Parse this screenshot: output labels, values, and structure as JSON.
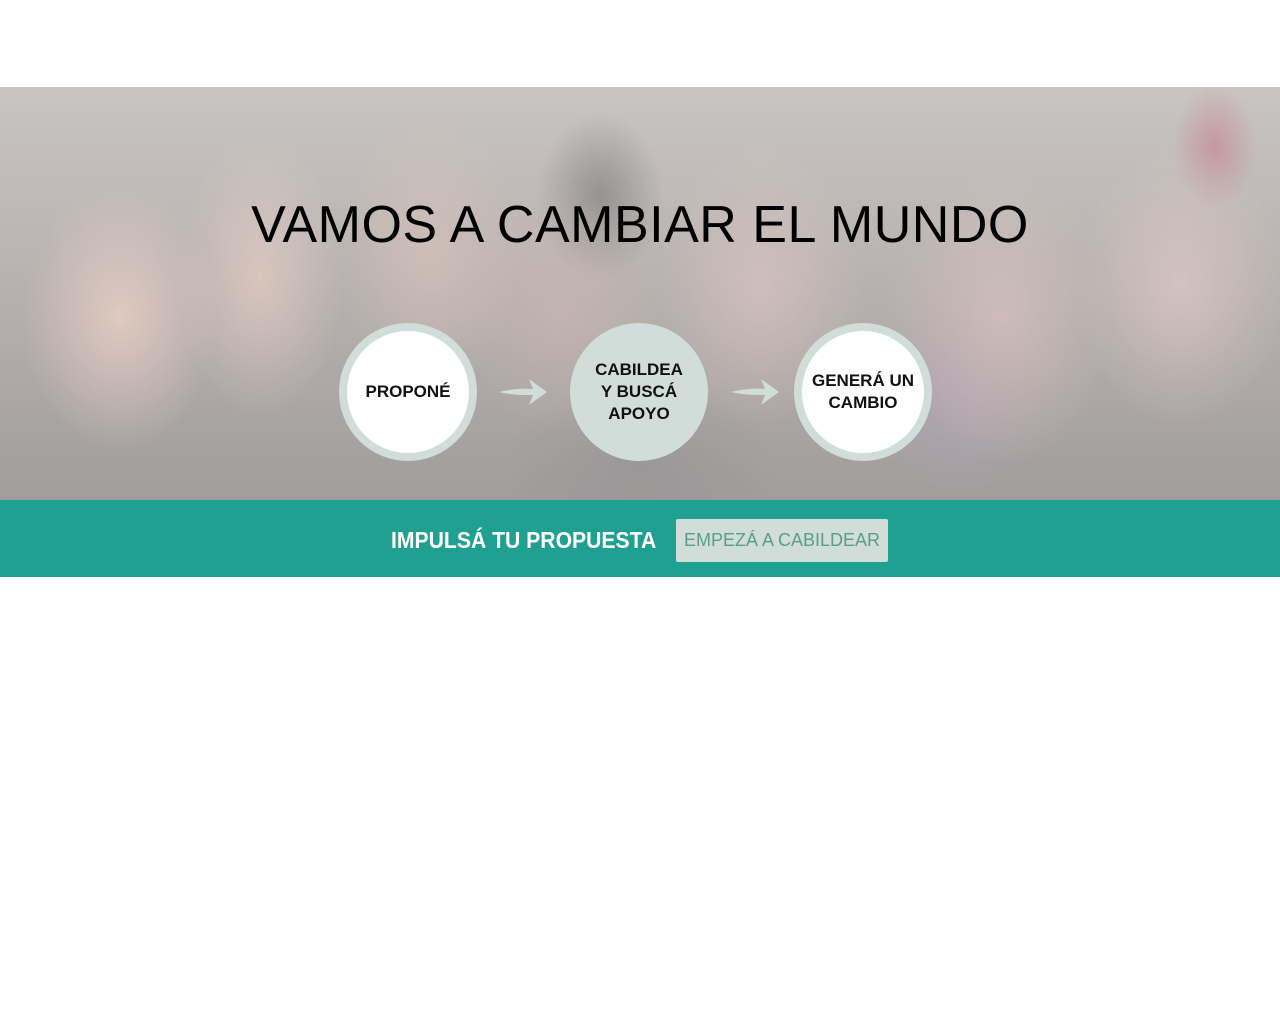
{
  "hero": {
    "title": "VAMOS A CAMBIAR EL MUNDO",
    "steps": [
      {
        "label": "PROPONÉ"
      },
      {
        "label": "CABILDEA\nY BUSCÁ\nAPOYO"
      },
      {
        "label": "GENERÁ UN\nCAMBIO"
      }
    ]
  },
  "cta": {
    "text": "IMPULSÁ TU PROPUESTA",
    "button_label": "EMPEZÁ A CABILDEAR"
  },
  "colors": {
    "accent": "#20a090",
    "circle_ring": "#d1ddd8",
    "button_text": "#5a9e8a"
  }
}
